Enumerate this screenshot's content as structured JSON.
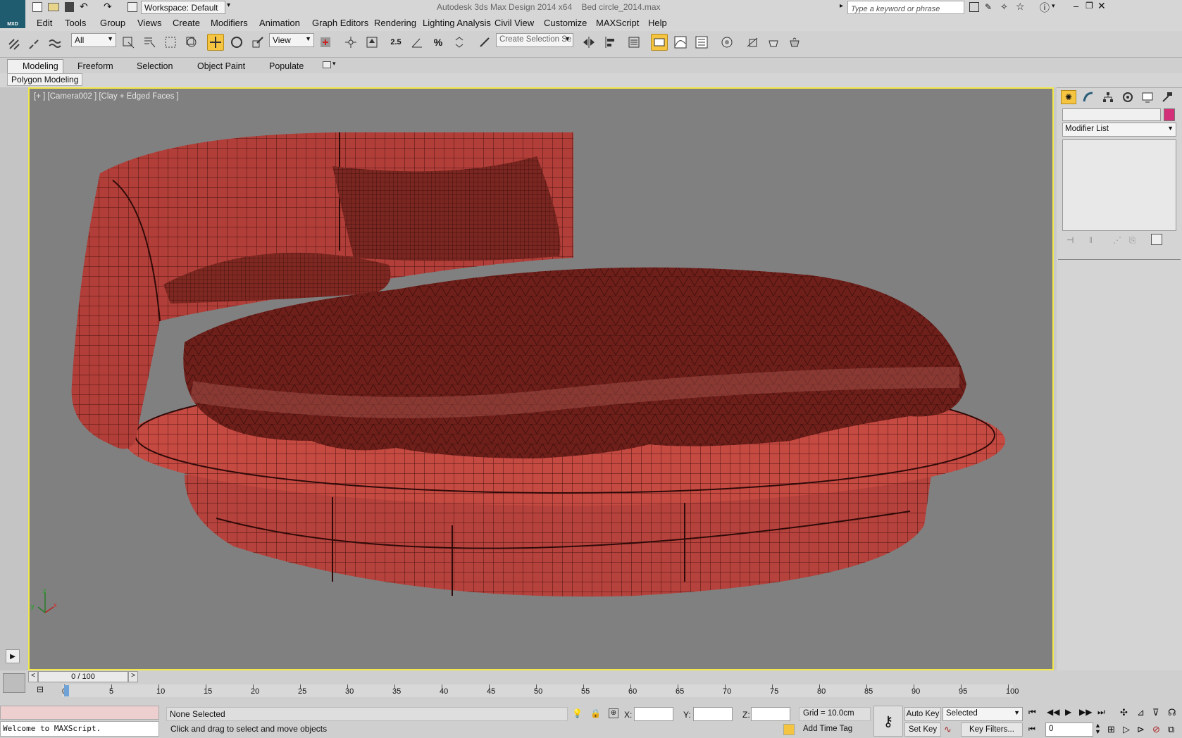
{
  "title_bar": {
    "app_badge": "MXD",
    "workspace_label": "Workspace: Default",
    "title": "Autodesk 3ds Max Design 2014 x64",
    "file_name": "Bed circle_2014.max",
    "search_placeholder": "Type a keyword or phrase"
  },
  "menu": {
    "items": [
      "Edit",
      "Tools",
      "Group",
      "Views",
      "Create",
      "Modifiers",
      "Animation",
      "Graph Editors",
      "Rendering",
      "Lighting Analysis",
      "Civil View",
      "Customize",
      "MAXScript",
      "Help"
    ]
  },
  "toolbar": {
    "filter_value": "All",
    "ref_coord_value": "View",
    "angle_snap_label": "2.5",
    "selection_set_placeholder": "Create Selection Se"
  },
  "ribbon": {
    "tabs": [
      "Modeling",
      "Freeform",
      "Selection",
      "Object Paint",
      "Populate"
    ],
    "active_tab": "Modeling",
    "panel_label": "Polygon Modeling"
  },
  "viewport": {
    "label": "[+ ] [Camera002 ] [Clay + Edged Faces ]",
    "axis_labels": {
      "x": "x",
      "y": "y",
      "z": "z"
    }
  },
  "command_panel": {
    "modifier_list": "Modifier List",
    "object_color": "#d4307a"
  },
  "timeline": {
    "frame_label": "0 / 100",
    "ticks": [
      "0",
      "5",
      "10",
      "15",
      "20",
      "25",
      "30",
      "35",
      "40",
      "45",
      "50",
      "55",
      "60",
      "65",
      "70",
      "75",
      "80",
      "85",
      "90",
      "95",
      "100"
    ]
  },
  "status": {
    "maxscript_text": "Welcome to MAXScript.",
    "selection_status": "None Selected",
    "prompt": "Click and drag to select and move objects",
    "x_label": "X:",
    "y_label": "Y:",
    "z_label": "Z:",
    "grid": "Grid = 10.0cm",
    "add_time_tag": "Add Time Tag",
    "auto_key": "Auto Key",
    "set_key": "Set Key",
    "selected_value": "Selected",
    "key_filters": "Key Filters...",
    "current_frame": "0"
  },
  "colors": {
    "viewport_bg": "#808080",
    "active_border": "#f1e84a",
    "mesh": "#b8423c",
    "wire": "#3a0e0b"
  }
}
